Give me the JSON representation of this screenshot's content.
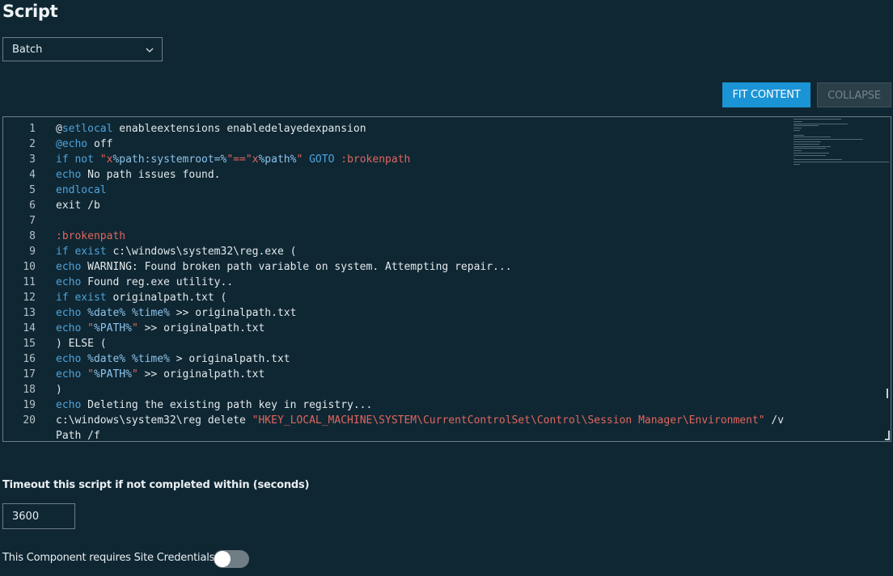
{
  "page": {
    "title": "Script"
  },
  "language_select": {
    "value": "Batch"
  },
  "buttons": {
    "fit_content": "FIT CONTENT",
    "collapse": "COLLAPSE"
  },
  "editor": {
    "lines": [
      {
        "num": "1",
        "segments": [
          {
            "t": "@",
            "c": "plain"
          },
          {
            "t": "setlocal",
            "c": "kw"
          },
          {
            "t": " enableextensions enabledelayedexpansion",
            "c": "plain"
          }
        ]
      },
      {
        "num": "2",
        "segments": [
          {
            "t": "@echo",
            "c": "kw"
          },
          {
            "t": " off",
            "c": "plain"
          }
        ]
      },
      {
        "num": "3",
        "segments": [
          {
            "t": "if not",
            "c": "kw"
          },
          {
            "t": " ",
            "c": "plain"
          },
          {
            "t": "\"x",
            "c": "str"
          },
          {
            "t": "%path:systemroot=%",
            "c": "var"
          },
          {
            "t": "\"==\"x",
            "c": "str"
          },
          {
            "t": "%path%",
            "c": "var"
          },
          {
            "t": "\"",
            "c": "str"
          },
          {
            "t": " ",
            "c": "plain"
          },
          {
            "t": "GOTO",
            "c": "kw"
          },
          {
            "t": " ",
            "c": "plain"
          },
          {
            "t": ":brokenpath",
            "c": "str"
          }
        ]
      },
      {
        "num": "4",
        "segments": [
          {
            "t": "echo",
            "c": "kw"
          },
          {
            "t": " No path issues found.",
            "c": "plain"
          }
        ]
      },
      {
        "num": "5",
        "segments": [
          {
            "t": "endlocal",
            "c": "kw"
          }
        ]
      },
      {
        "num": "6",
        "segments": [
          {
            "t": "exit /b",
            "c": "plain"
          }
        ]
      },
      {
        "num": "7",
        "segments": []
      },
      {
        "num": "8",
        "segments": [
          {
            "t": ":brokenpath",
            "c": "str"
          }
        ]
      },
      {
        "num": "9",
        "segments": [
          {
            "t": "if exist",
            "c": "kw"
          },
          {
            "t": " c:\\windows\\system32\\reg.exe (",
            "c": "plain"
          }
        ]
      },
      {
        "num": "10",
        "segments": [
          {
            "t": "echo",
            "c": "kw"
          },
          {
            "t": " WARNING: Found broken path variable on system. Attempting repair...",
            "c": "plain"
          }
        ]
      },
      {
        "num": "11",
        "segments": [
          {
            "t": "echo",
            "c": "kw"
          },
          {
            "t": " Found reg.exe utility..",
            "c": "plain"
          }
        ]
      },
      {
        "num": "12",
        "segments": [
          {
            "t": "if exist",
            "c": "kw"
          },
          {
            "t": " originalpath.txt (",
            "c": "plain"
          }
        ]
      },
      {
        "num": "13",
        "segments": [
          {
            "t": "echo",
            "c": "kw"
          },
          {
            "t": " ",
            "c": "plain"
          },
          {
            "t": "%date%",
            "c": "var"
          },
          {
            "t": " ",
            "c": "plain"
          },
          {
            "t": "%time%",
            "c": "var"
          },
          {
            "t": " >> originalpath.txt",
            "c": "plain"
          }
        ]
      },
      {
        "num": "14",
        "segments": [
          {
            "t": "echo",
            "c": "kw"
          },
          {
            "t": " ",
            "c": "plain"
          },
          {
            "t": "\"",
            "c": "str"
          },
          {
            "t": "%PATH%",
            "c": "var"
          },
          {
            "t": "\"",
            "c": "str"
          },
          {
            "t": " >> originalpath.txt",
            "c": "plain"
          }
        ]
      },
      {
        "num": "15",
        "segments": [
          {
            "t": ") ELSE (",
            "c": "plain"
          }
        ]
      },
      {
        "num": "16",
        "segments": [
          {
            "t": "echo",
            "c": "kw"
          },
          {
            "t": " ",
            "c": "plain"
          },
          {
            "t": "%date%",
            "c": "var"
          },
          {
            "t": " ",
            "c": "plain"
          },
          {
            "t": "%time%",
            "c": "var"
          },
          {
            "t": " > originalpath.txt",
            "c": "plain"
          }
        ]
      },
      {
        "num": "17",
        "segments": [
          {
            "t": "echo",
            "c": "kw"
          },
          {
            "t": " ",
            "c": "plain"
          },
          {
            "t": "\"",
            "c": "str"
          },
          {
            "t": "%PATH%",
            "c": "var"
          },
          {
            "t": "\"",
            "c": "str"
          },
          {
            "t": " >> originalpath.txt",
            "c": "plain"
          }
        ]
      },
      {
        "num": "18",
        "segments": [
          {
            "t": ")",
            "c": "plain"
          }
        ]
      },
      {
        "num": "19",
        "segments": [
          {
            "t": "echo",
            "c": "kw"
          },
          {
            "t": " Deleting the existing path key in registry...",
            "c": "plain"
          }
        ]
      },
      {
        "num": "20",
        "segments": [
          {
            "t": "c:\\windows\\system32\\reg delete ",
            "c": "plain"
          },
          {
            "t": "\"HKEY_LOCAL_MACHINE\\SYSTEM\\CurrentControlSet\\Control\\Session Manager\\Environment\"",
            "c": "str"
          },
          {
            "t": " /v",
            "c": "plain"
          }
        ]
      },
      {
        "num": "",
        "segments": [
          {
            "t": "Path /f",
            "c": "plain"
          }
        ]
      }
    ]
  },
  "timeout": {
    "label": "Timeout this script if not completed within (seconds)",
    "value": "3600"
  },
  "credentials": {
    "label": "This Component requires Site Credentials",
    "enabled": false
  },
  "colors": {
    "background": "#0f2733",
    "accent": "#1b94d6",
    "keyword": "#4fa3d9",
    "string": "#e0665e"
  }
}
